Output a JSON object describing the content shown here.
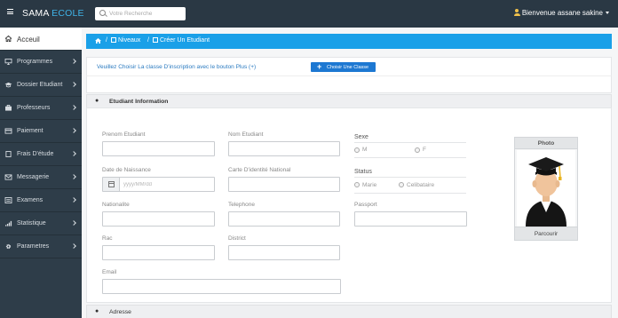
{
  "header": {
    "brand_part1": "SAMA",
    "brand_part2": "ECOLE",
    "search_placeholder": "Votre Recherche",
    "user_greeting": "Bienvenue assane sakine"
  },
  "sidebar": {
    "items": [
      {
        "label": "Acceuil",
        "icon": "home-icon"
      },
      {
        "label": "Programmes",
        "icon": "monitor-icon"
      },
      {
        "label": "Dossier Etudiant",
        "icon": "graduation-cap-icon"
      },
      {
        "label": "Professeurs",
        "icon": "briefcase-icon"
      },
      {
        "label": "Paiement",
        "icon": "credit-card-icon"
      },
      {
        "label": "Frais D'étude",
        "icon": "document-icon"
      },
      {
        "label": "Messagerie",
        "icon": "envelope-icon"
      },
      {
        "label": "Examens",
        "icon": "list-icon"
      },
      {
        "label": "Statistique",
        "icon": "signal-icon"
      },
      {
        "label": "Parametres",
        "icon": "gear-icon"
      }
    ]
  },
  "breadcrumb": {
    "sep": "/",
    "level1": "Niveaux",
    "level2": "Créer Un Etudiant"
  },
  "choose_class": {
    "instruction": "Veuillez Choisir La classe D'inscription avec le bouton Plus (+)",
    "button_icon": "+",
    "button_label": "Choisir Une Classe"
  },
  "student_section": {
    "title": "Etudiant Information",
    "fields": {
      "prenom": {
        "label": "Prenom Etudiant",
        "value": ""
      },
      "nom": {
        "label": "Nom Etudiant",
        "value": ""
      },
      "date_naissance": {
        "label": "Date de Naissance",
        "placeholder": "yyyy/MM/dd",
        "value": ""
      },
      "carte": {
        "label": "Carte D'identité National",
        "value": ""
      },
      "nationalite": {
        "label": "Nationalite",
        "value": ""
      },
      "telephone": {
        "label": "Telephone",
        "value": ""
      },
      "passport": {
        "label": "Passport",
        "value": ""
      },
      "rac": {
        "label": "Rac",
        "value": ""
      },
      "district": {
        "label": "District",
        "value": ""
      },
      "email": {
        "label": "Email",
        "value": ""
      }
    },
    "sexe": {
      "label": "Sexe",
      "options": [
        "M",
        "F"
      ]
    },
    "status": {
      "label": "Status",
      "options": [
        "Marie",
        "Celibataire"
      ]
    },
    "photo": {
      "title": "Photo",
      "browse": "Parcourir"
    }
  },
  "address_section": {
    "title": "Adresse"
  },
  "colors": {
    "topbar": "#2a3844",
    "sidebar": "#2e3d49",
    "breadcrumb": "#1aa0e8",
    "brand_accent": "#3fb3e8",
    "button": "#1d78d2",
    "link_text": "#2a7ac0"
  }
}
